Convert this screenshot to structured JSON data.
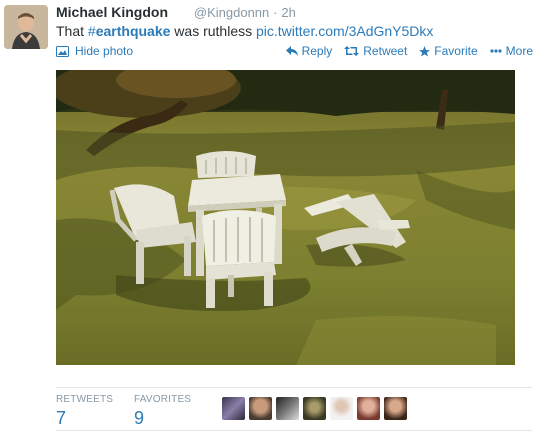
{
  "tweet": {
    "author_name": "Michael Kingdon",
    "handle": "@Kingdonnn",
    "separator": "·",
    "time": "2h",
    "text_prefix": "That ",
    "hashtag_symbol": "#",
    "hashtag_word": "earthquake",
    "text_mid": " was ruthless ",
    "link": "pic.twitter.com/3AdGnY5Dkx"
  },
  "media": {
    "hide_label": "Hide photo",
    "photo_icon": "photo-icon"
  },
  "actions": {
    "reply": "Reply",
    "retweet": "Retweet",
    "favorite": "Favorite",
    "more": "More"
  },
  "stats": {
    "retweets_label": "RETWEETS",
    "retweets_count": "7",
    "favorites_label": "FAVORITES",
    "favorites_count": "9"
  },
  "colors": {
    "link_blue": "#2b7bb9",
    "muted_gray": "#8899a6"
  }
}
